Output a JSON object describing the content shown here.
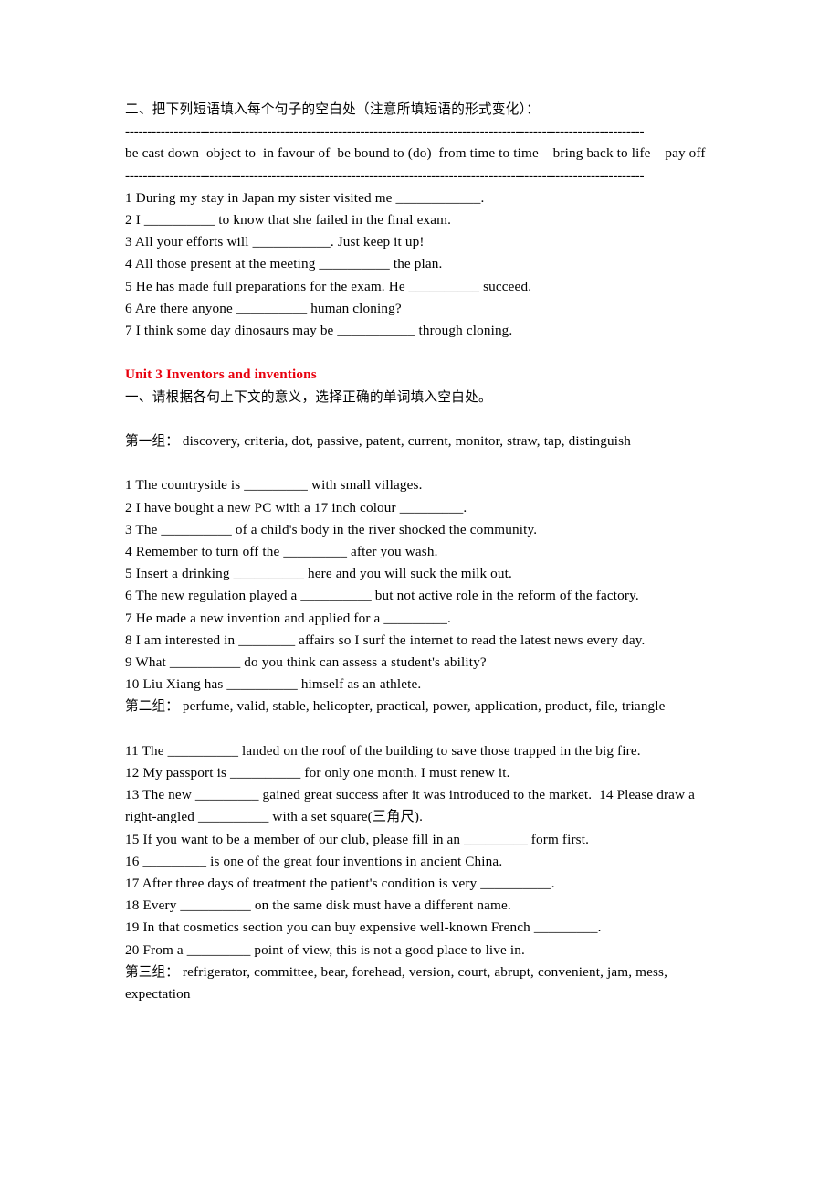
{
  "document": {
    "section_two_heading": "二、把下列短语填入每个句子的空白处（注意所填短语的形式变化）：",
    "separator": "---------------------------------------------------------------------------------------------------------------------",
    "phrase_bank": "be cast down  object to  in favour of  be bound to (do)  from time to time    bring back to life    pay off",
    "section_two_items": [
      "1 During my stay in Japan my sister visited me ____________.",
      "2 I __________ to know that she failed in the final exam.",
      "3 All your efforts will ___________. Just keep it up!",
      "4 All those present at the meeting __________ the plan.",
      "5 He has made full preparations for the exam. He __________ succeed.",
      "6 Are there anyone __________ human cloning?",
      "7 I think some day dinosaurs may be ___________ through cloning."
    ],
    "unit_heading": "Unit 3   Inventors and inventions",
    "section_one_heading": "一、请根据各句上下文的意义，选择正确的单词填入空白处。",
    "group_one_label": "第一组：",
    "group_one_words": " discovery, criteria, dot, passive, patent, current, monitor, straw, tap, distinguish",
    "group_one_items": [
      "1 The countryside is _________ with small villages.",
      "2 I have bought a new PC with a 17 inch colour _________.",
      "3 The __________ of a child's body in the river shocked the community.",
      "4 Remember to turn off the _________ after you wash.",
      "5 Insert a drinking __________ here and you will suck the milk out.",
      "6 The new regulation played a __________ but not active role in the reform of the factory.",
      "7 He made a new invention and applied for a _________.",
      "8 I am interested in ________ affairs so I surf the internet to read the latest news every day.",
      "9 What __________ do you think can assess a student's ability?",
      "10 Liu Xiang has __________ himself as an athlete."
    ],
    "group_two_label": "第二组：",
    "group_two_words": " perfume, valid, stable, helicopter, practical, power, application, product, file, triangle",
    "group_two_items": [
      "11 The __________ landed on the roof of the building to save those trapped in the big fire.",
      "12 My passport is __________ for only one month. I must renew it.",
      "13 The new _________ gained great success after it was introduced to the market.  14 Please draw a right-angled __________ with a set square(三角尺).",
      "15 If you want to be a member of our club, please fill in an _________ form first.",
      "16 _________ is one of the great four inventions in ancient China.",
      "17 After three days of treatment the patient's condition is very __________.",
      "18 Every __________ on the same disk must have a different name.",
      "19 In that cosmetics section you can buy expensive well-known French _________.",
      "20 From a _________ point of view, this is not a good place to live in."
    ],
    "group_three_label": "第三组：",
    "group_three_words": " refrigerator, committee, bear, forehead, version, court, abrupt, convenient, jam, mess, expectation"
  },
  "colors": {
    "heading_red": "#E8000D",
    "text_black": "#000000",
    "page_background": "#ffffff"
  }
}
